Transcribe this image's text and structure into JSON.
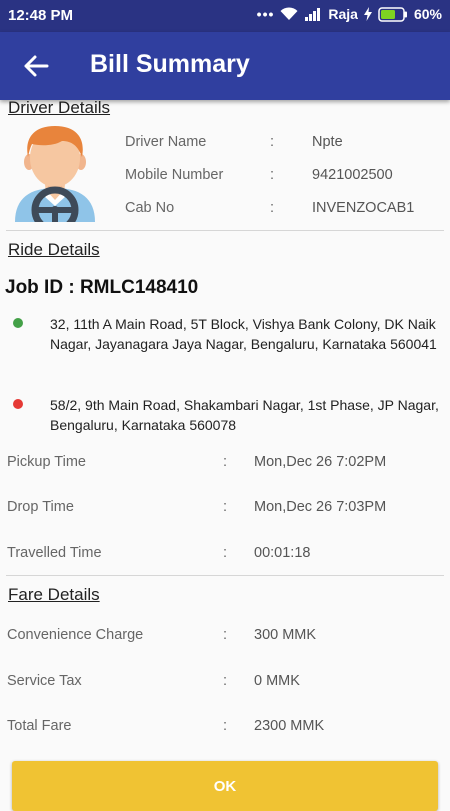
{
  "status_bar": {
    "time": "12:48 PM",
    "carrier": "Raja",
    "battery": "60%"
  },
  "app_bar": {
    "title": "Bill Summary"
  },
  "driver": {
    "section_title": "Driver Details",
    "rows": [
      {
        "label": "Driver Name",
        "value": "Npte"
      },
      {
        "label": "Mobile Number",
        "value": "9421002500"
      },
      {
        "label": "Cab No",
        "value": "INVENZOCAB1"
      }
    ]
  },
  "ride": {
    "section_title": "Ride Details",
    "job_id": "Job ID : RMLC148410",
    "pickup_address": "32, 11th A Main Road, 5T Block, Vishya Bank Colony, DK Naik Nagar, Jayanagara Jaya Nagar, Bengaluru, Karnataka 560041",
    "drop_address": "58/2, 9th Main Road, Shakambari Nagar, 1st Phase, JP Nagar, Bengaluru, Karnataka 560078",
    "rows": [
      {
        "label": "Pickup Time",
        "value": "Mon,Dec 26 7:02PM"
      },
      {
        "label": "Drop Time",
        "value": "Mon,Dec 26 7:03PM"
      },
      {
        "label": "Travelled Time",
        "value": "00:01:18"
      }
    ]
  },
  "fare": {
    "section_title": "Fare Details",
    "rows": [
      {
        "label": "Convenience Charge",
        "value": "300 MMK"
      },
      {
        "label": "Service Tax",
        "value": "0 MMK"
      },
      {
        "label": "Total Fare",
        "value": "2300 MMK"
      }
    ]
  },
  "colon": ":",
  "ok_label": "OK",
  "colors": {
    "status_bar": "#2a3383",
    "app_bar": "#303f9f",
    "pickup_dot": "#43a047",
    "drop_dot": "#e53935",
    "ok_button": "#f0c333"
  }
}
